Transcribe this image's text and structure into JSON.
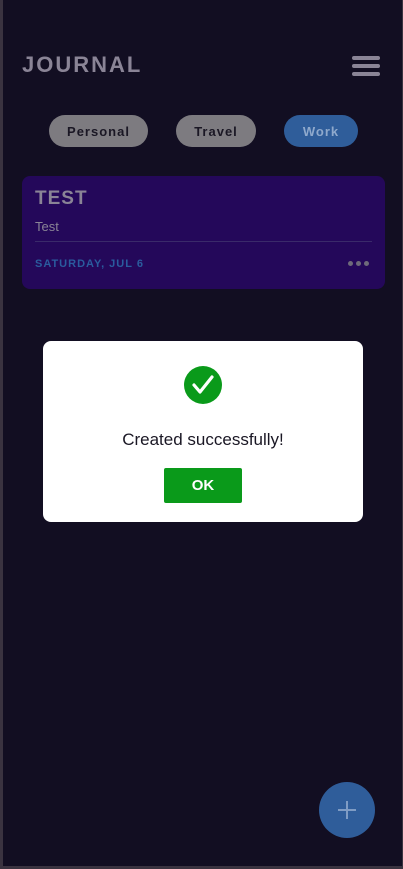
{
  "header": {
    "title": "JOURNAL",
    "menu_icon": "hamburger-menu-icon"
  },
  "filters": [
    {
      "label": "Personal",
      "selected": false
    },
    {
      "label": "Travel",
      "selected": false
    },
    {
      "label": "Work",
      "selected": true
    }
  ],
  "entries": [
    {
      "title": "TEST",
      "body": "Test",
      "date": "SATURDAY, JUL 6",
      "more_icon": "more-horizontal-icon"
    }
  ],
  "fab": {
    "icon": "plus-icon"
  },
  "dialog": {
    "icon": "check-circle-icon",
    "message": "Created successfully!",
    "ok_label": "OK"
  },
  "colors": {
    "background": "#120e22",
    "card": "#24085a",
    "accent": "#2f5d9a",
    "success": "#0a9a1a"
  }
}
